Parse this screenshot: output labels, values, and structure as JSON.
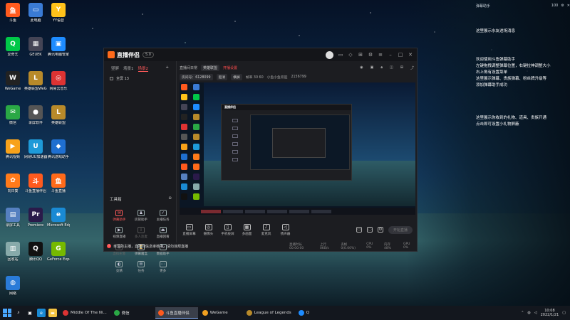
{
  "desktop": {
    "icons": [
      {
        "label": "斗鱼",
        "glyph": "鱼",
        "color": "#ff5a1e"
      },
      {
        "label": "此电脑",
        "glyph": "▭",
        "color": "#3a7bd5"
      },
      {
        "label": "YY语音",
        "glyph": "Y",
        "color": "#ffc21a"
      },
      {
        "label": "爱奇艺",
        "glyph": "Q",
        "color": "#00c848"
      },
      {
        "label": "GEUEK",
        "glyph": "▦",
        "color": "#445"
      },
      {
        "label": "腾讯电脑管家",
        "glyph": "▣",
        "color": "#1e8cff"
      },
      {
        "label": "WeGame",
        "glyph": "W",
        "color": "#222"
      },
      {
        "label": "英雄联盟WeGame版",
        "glyph": "L",
        "color": "#b88a2a"
      },
      {
        "label": "网易云音乐",
        "glyph": "◎",
        "color": "#d33"
      },
      {
        "label": "微信",
        "glyph": "✉",
        "color": "#2aa845"
      },
      {
        "label": "录屏软件",
        "glyph": "●",
        "color": "#555"
      },
      {
        "label": "英雄联盟",
        "glyph": "L",
        "color": "#b88a2a"
      },
      {
        "label": "腾讯视频",
        "glyph": "▶",
        "color": "#f8a21a"
      },
      {
        "label": "网易UU加速器",
        "glyph": "U",
        "color": "#1e9ad8"
      },
      {
        "label": "腾讯游戏助手",
        "glyph": "◆",
        "color": "#1f6fd0"
      },
      {
        "label": "向日葵",
        "glyph": "✿",
        "color": "#ff7a1a"
      },
      {
        "label": "斗鱼直播伴侣",
        "glyph": "斗",
        "color": "#ff5a1e"
      },
      {
        "label": "斗鱼直播",
        "glyph": "鱼",
        "color": "#ff6a1a"
      },
      {
        "label": "录屏工具",
        "glyph": "▤",
        "color": "#5580c0"
      },
      {
        "label": "Premiere",
        "glyph": "Pr",
        "color": "#2a1a4a"
      },
      {
        "label": "Microsoft Edge",
        "glyph": "e",
        "color": "#1a8ad4"
      },
      {
        "label": "回收站",
        "glyph": "▥",
        "color": "#8aa"
      },
      {
        "label": "腾讯QQ",
        "glyph": "Q",
        "color": "#111"
      },
      {
        "label": "GeForce Experience",
        "glyph": "G",
        "color": "#76b900"
      },
      {
        "label": "网络",
        "glyph": "◍",
        "color": "#2a7bd8"
      }
    ],
    "notes": [
      "这里展示水友进场消息",
      "欢迎使用斗鱼弹幕助手",
      "左键拖拽调整弹幕位置，右键拉伸调整大小",
      "右上角有设置菜单",
      "这里展示弹幕、贵族弹幕、粉丝牌升级等",
      "添加弹幕助手成功",
      "这里展示你收到的礼物、道具、贵族开通",
      "点击即可设置小礼物屏蔽"
    ],
    "notes_top": {
      "title": "弹幕助手",
      "count": "100"
    }
  },
  "window": {
    "logo": "直播伴侣",
    "version": "5.0",
    "scene_tabs": [
      "竖屏",
      "场景1",
      "场景2"
    ],
    "active_scene": "场景2",
    "source_label": "全屏 13",
    "tools_title": "工具箱",
    "tools": [
      {
        "label": "弹幕助手",
        "glyph": "✉",
        "state": "hot"
      },
      {
        "label": "房管助手",
        "glyph": "♟",
        "state": "on"
      },
      {
        "label": "主播任务",
        "glyph": "✓",
        "state": "on"
      },
      {
        "label": "视频直播",
        "glyph": "▶",
        "state": "on"
      },
      {
        "label": "多人连麦",
        "glyph": "⇩",
        "state": "dim"
      },
      {
        "label": "直播回看",
        "glyph": "⏏",
        "state": "on"
      },
      {
        "label": "虚拟形象",
        "glyph": "◉",
        "state": "dim"
      },
      {
        "label": "弹幕魔盒",
        "glyph": "⏳",
        "state": "on"
      },
      {
        "label": "数据助手",
        "glyph": "↻",
        "state": "on"
      },
      {
        "label": "竞猜",
        "glyph": "◐",
        "state": "on"
      },
      {
        "label": "任务",
        "glyph": "☰",
        "state": "on"
      },
      {
        "label": "更多",
        "glyph": "⋯",
        "state": "on"
      }
    ],
    "preview_bar": {
      "title": "直播间日常",
      "category": "英雄联盟",
      "red_tag": "开播设置",
      "room_label": "房间号：6128099"
    },
    "preview_bar2": {
      "quality": "超清",
      "mode": "横屏",
      "fps": "帧率 30 60",
      "hint": "小鱼小鱼欢迎",
      "bitrate": "2156799"
    },
    "controls": [
      {
        "label": "直播屏幕",
        "glyph": "▭"
      },
      {
        "label": "摄像头",
        "glyph": "◎"
      },
      {
        "label": "手机投屏",
        "glyph": "▯"
      },
      {
        "label": "多画面",
        "glyph": "▦"
      },
      {
        "label": "麦克风",
        "glyph": "♪"
      },
      {
        "label": "扬声器",
        "glyph": "◁"
      }
    ],
    "go_live": "开始直播",
    "status": [
      "直播时长 00:00:00",
      "上行 0KB/s",
      "丢帧 0(0.00%)",
      "CPU 0%",
      "内存 48%",
      "GPU 0%"
    ],
    "notice": "亲爱的主播，直播间信息审核中，请勿违规直播"
  },
  "taskbar": {
    "apps": [
      {
        "label": "Middle Of The Ni...",
        "color": "#d33",
        "active": false
      },
      {
        "label": "微信",
        "color": "#2aa845",
        "active": false
      },
      {
        "label": "斗鱼直播伴侣",
        "color": "#ff5a1e",
        "active": true
      },
      {
        "label": "WeGame",
        "color": "#f0a020",
        "active": false
      },
      {
        "label": "League of Legends",
        "color": "#b88a2a",
        "active": false
      },
      {
        "label": "Q",
        "color": "#1e8cff",
        "active": false
      }
    ],
    "time": "10:08",
    "date": "2022/1/21"
  }
}
